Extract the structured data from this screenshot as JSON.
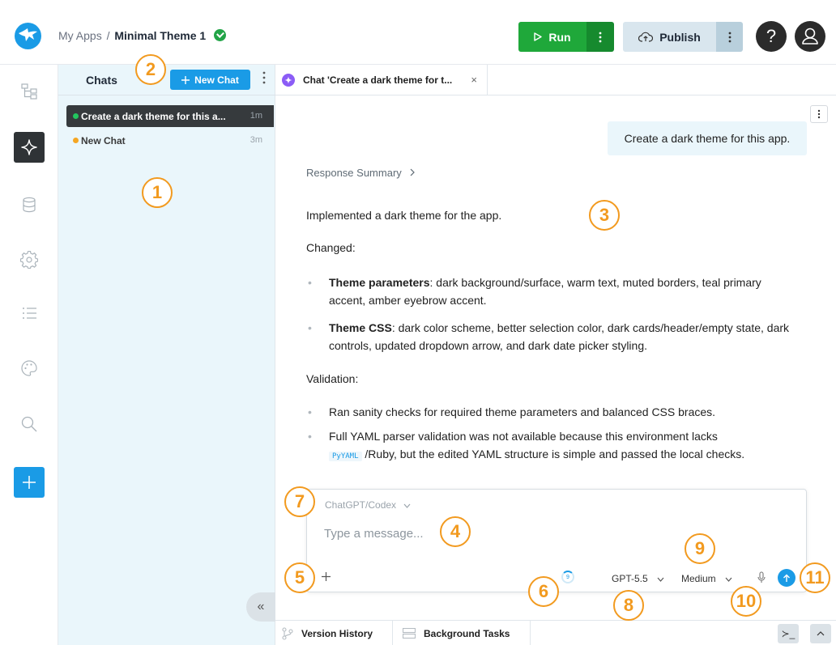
{
  "header": {
    "breadcrumb_root": "My Apps",
    "breadcrumb_sep": "/",
    "app_name": "Minimal Theme 1",
    "run_label": "Run",
    "publish_label": "Publish",
    "help_label": "?"
  },
  "chats": {
    "title": "Chats",
    "new_chat_label": "New Chat",
    "items": [
      {
        "label": "Create a dark theme for this a...",
        "time": "1m",
        "status_color": "#22c55e"
      },
      {
        "label": "New Chat",
        "time": "3m",
        "status_color": "#f5a623"
      }
    ],
    "collapse_glyph": "«"
  },
  "tab": {
    "label": "Chat 'Create a dark theme for t...",
    "close_glyph": "×"
  },
  "conversation": {
    "user_message": "Create a dark theme for this app.",
    "response_summary_label": "Response Summary",
    "intro": "Implemented a dark theme for the app.",
    "changed_heading": "Changed:",
    "changed_items": [
      {
        "bold": "Theme parameters",
        "text": ": dark background/surface, warm text, muted borders, teal primary accent, amber eyebrow accent."
      },
      {
        "bold": "Theme CSS",
        "text": ": dark color scheme, better selection color, dark cards/header/empty state, dark controls, updated dropdown arrow, and dark date picker styling."
      }
    ],
    "validation_heading": "Validation:",
    "validation_items": [
      "Ran sanity checks for required theme parameters and balanced CSS braces.",
      "Full YAML parser validation was not available because this environment lacks"
    ],
    "validation_code": "PyYAML",
    "validation_tail": "/Ruby, but the edited YAML structure is simple and passed the local checks."
  },
  "composer": {
    "provider": "ChatGPT/Codex",
    "placeholder": "Type a message...",
    "context_value": "9",
    "model": "GPT-5.5",
    "effort": "Medium"
  },
  "bottom": {
    "version_history": "Version History",
    "background_tasks": "Background Tasks",
    "terminal_glyph": "≻_",
    "up_glyph": "^"
  },
  "markers": [
    "1",
    "2",
    "3",
    "4",
    "5",
    "6",
    "7",
    "8",
    "9",
    "10",
    "11"
  ],
  "colors": {
    "accent_blue": "#1a9be6",
    "run_green": "#1fa83a",
    "marker_orange": "#f29a1f",
    "chat_panel_bg": "#eaf6fb"
  }
}
